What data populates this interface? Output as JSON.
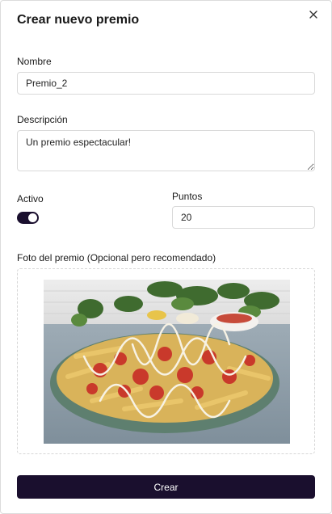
{
  "modal": {
    "title": "Crear nuevo premio",
    "close_icon": "close-icon"
  },
  "form": {
    "nombre": {
      "label": "Nombre",
      "value": "Premio_2"
    },
    "descripcion": {
      "label": "Descripción",
      "value": "Un premio espectacular!"
    },
    "activo": {
      "label": "Activo",
      "checked": true
    },
    "puntos": {
      "label": "Puntos",
      "value": "20"
    },
    "foto": {
      "label": "Foto del premio (Opcional pero recomendado)",
      "image": "fries-with-sausage-photo"
    }
  },
  "actions": {
    "submit_label": "Crear"
  },
  "colors": {
    "primary": "#1a0f2e",
    "border": "#d9d9d9",
    "background": "#ffffff"
  }
}
